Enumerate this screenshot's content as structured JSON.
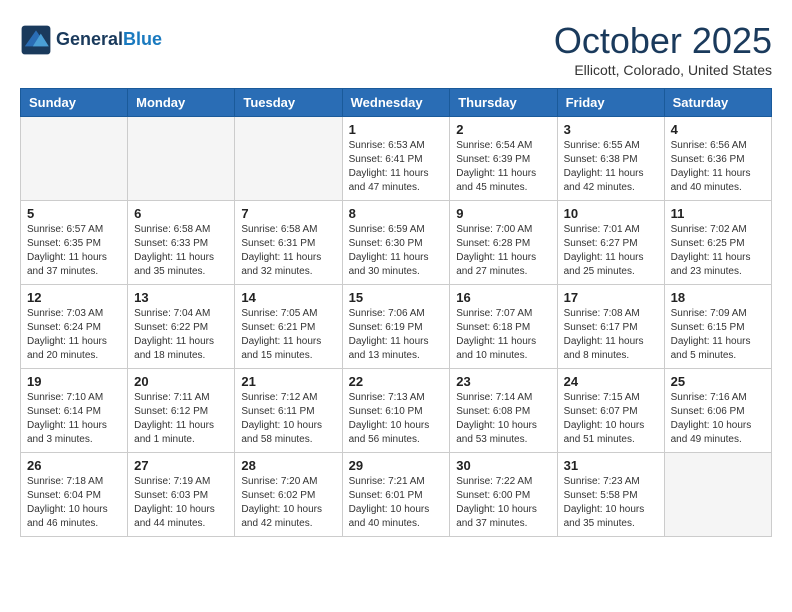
{
  "header": {
    "logo_line1": "General",
    "logo_line2": "Blue",
    "title": "October 2025",
    "subtitle": "Ellicott, Colorado, United States"
  },
  "days_of_week": [
    "Sunday",
    "Monday",
    "Tuesday",
    "Wednesday",
    "Thursday",
    "Friday",
    "Saturday"
  ],
  "weeks": [
    [
      {
        "day": "",
        "info": ""
      },
      {
        "day": "",
        "info": ""
      },
      {
        "day": "",
        "info": ""
      },
      {
        "day": "1",
        "info": "Sunrise: 6:53 AM\nSunset: 6:41 PM\nDaylight: 11 hours\nand 47 minutes."
      },
      {
        "day": "2",
        "info": "Sunrise: 6:54 AM\nSunset: 6:39 PM\nDaylight: 11 hours\nand 45 minutes."
      },
      {
        "day": "3",
        "info": "Sunrise: 6:55 AM\nSunset: 6:38 PM\nDaylight: 11 hours\nand 42 minutes."
      },
      {
        "day": "4",
        "info": "Sunrise: 6:56 AM\nSunset: 6:36 PM\nDaylight: 11 hours\nand 40 minutes."
      }
    ],
    [
      {
        "day": "5",
        "info": "Sunrise: 6:57 AM\nSunset: 6:35 PM\nDaylight: 11 hours\nand 37 minutes."
      },
      {
        "day": "6",
        "info": "Sunrise: 6:58 AM\nSunset: 6:33 PM\nDaylight: 11 hours\nand 35 minutes."
      },
      {
        "day": "7",
        "info": "Sunrise: 6:58 AM\nSunset: 6:31 PM\nDaylight: 11 hours\nand 32 minutes."
      },
      {
        "day": "8",
        "info": "Sunrise: 6:59 AM\nSunset: 6:30 PM\nDaylight: 11 hours\nand 30 minutes."
      },
      {
        "day": "9",
        "info": "Sunrise: 7:00 AM\nSunset: 6:28 PM\nDaylight: 11 hours\nand 27 minutes."
      },
      {
        "day": "10",
        "info": "Sunrise: 7:01 AM\nSunset: 6:27 PM\nDaylight: 11 hours\nand 25 minutes."
      },
      {
        "day": "11",
        "info": "Sunrise: 7:02 AM\nSunset: 6:25 PM\nDaylight: 11 hours\nand 23 minutes."
      }
    ],
    [
      {
        "day": "12",
        "info": "Sunrise: 7:03 AM\nSunset: 6:24 PM\nDaylight: 11 hours\nand 20 minutes."
      },
      {
        "day": "13",
        "info": "Sunrise: 7:04 AM\nSunset: 6:22 PM\nDaylight: 11 hours\nand 18 minutes."
      },
      {
        "day": "14",
        "info": "Sunrise: 7:05 AM\nSunset: 6:21 PM\nDaylight: 11 hours\nand 15 minutes."
      },
      {
        "day": "15",
        "info": "Sunrise: 7:06 AM\nSunset: 6:19 PM\nDaylight: 11 hours\nand 13 minutes."
      },
      {
        "day": "16",
        "info": "Sunrise: 7:07 AM\nSunset: 6:18 PM\nDaylight: 11 hours\nand 10 minutes."
      },
      {
        "day": "17",
        "info": "Sunrise: 7:08 AM\nSunset: 6:17 PM\nDaylight: 11 hours\nand 8 minutes."
      },
      {
        "day": "18",
        "info": "Sunrise: 7:09 AM\nSunset: 6:15 PM\nDaylight: 11 hours\nand 5 minutes."
      }
    ],
    [
      {
        "day": "19",
        "info": "Sunrise: 7:10 AM\nSunset: 6:14 PM\nDaylight: 11 hours\nand 3 minutes."
      },
      {
        "day": "20",
        "info": "Sunrise: 7:11 AM\nSunset: 6:12 PM\nDaylight: 11 hours\nand 1 minute."
      },
      {
        "day": "21",
        "info": "Sunrise: 7:12 AM\nSunset: 6:11 PM\nDaylight: 10 hours\nand 58 minutes."
      },
      {
        "day": "22",
        "info": "Sunrise: 7:13 AM\nSunset: 6:10 PM\nDaylight: 10 hours\nand 56 minutes."
      },
      {
        "day": "23",
        "info": "Sunrise: 7:14 AM\nSunset: 6:08 PM\nDaylight: 10 hours\nand 53 minutes."
      },
      {
        "day": "24",
        "info": "Sunrise: 7:15 AM\nSunset: 6:07 PM\nDaylight: 10 hours\nand 51 minutes."
      },
      {
        "day": "25",
        "info": "Sunrise: 7:16 AM\nSunset: 6:06 PM\nDaylight: 10 hours\nand 49 minutes."
      }
    ],
    [
      {
        "day": "26",
        "info": "Sunrise: 7:18 AM\nSunset: 6:04 PM\nDaylight: 10 hours\nand 46 minutes."
      },
      {
        "day": "27",
        "info": "Sunrise: 7:19 AM\nSunset: 6:03 PM\nDaylight: 10 hours\nand 44 minutes."
      },
      {
        "day": "28",
        "info": "Sunrise: 7:20 AM\nSunset: 6:02 PM\nDaylight: 10 hours\nand 42 minutes."
      },
      {
        "day": "29",
        "info": "Sunrise: 7:21 AM\nSunset: 6:01 PM\nDaylight: 10 hours\nand 40 minutes."
      },
      {
        "day": "30",
        "info": "Sunrise: 7:22 AM\nSunset: 6:00 PM\nDaylight: 10 hours\nand 37 minutes."
      },
      {
        "day": "31",
        "info": "Sunrise: 7:23 AM\nSunset: 5:58 PM\nDaylight: 10 hours\nand 35 minutes."
      },
      {
        "day": "",
        "info": ""
      }
    ]
  ]
}
